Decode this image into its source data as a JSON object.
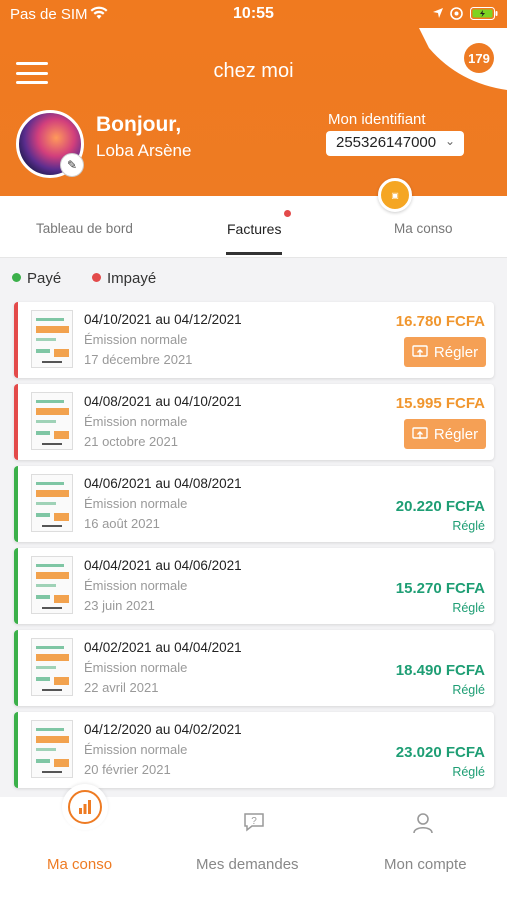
{
  "status": {
    "carrier": "Pas de SIM",
    "time": "10:55"
  },
  "header": {
    "title": "chez moi",
    "badge_text": "179"
  },
  "profile": {
    "greeting": "Bonjour,",
    "name": "Loba Arsène",
    "id_label": "Mon identifiant",
    "id_value": "255326147000"
  },
  "tabs": [
    {
      "label": "Tableau de bord"
    },
    {
      "label": "Factures"
    },
    {
      "label": "Ma conso"
    }
  ],
  "legend": {
    "paid": "Payé",
    "unpaid": "Impayé"
  },
  "colors": {
    "accent": "#ee7b23",
    "paid": "#1e9e74",
    "unpaid": "#e34a4a",
    "amount_unpaid": "#f0962e"
  },
  "invoices": [
    {
      "period": "04/10/2021 au 04/12/2021",
      "type": "Émission normale",
      "date": "17 décembre 2021",
      "amount": "16.780 FCFA",
      "action": "Régler"
    },
    {
      "period": "04/08/2021 au 04/10/2021",
      "type": "Émission normale",
      "date": "21 octobre 2021",
      "amount": "15.995 FCFA",
      "action": "Régler"
    },
    {
      "period": "04/06/2021 au 04/08/2021",
      "type": "Émission normale",
      "date": "16 août 2021",
      "amount": "20.220 FCFA",
      "status": "Réglé"
    },
    {
      "period": "04/04/2021 au 04/06/2021",
      "type": "Émission normale",
      "date": "23 juin 2021",
      "amount": "15.270 FCFA",
      "status": "Réglé"
    },
    {
      "period": "04/02/2021 au 04/04/2021",
      "type": "Émission normale",
      "date": "22 avril 2021",
      "amount": "18.490 FCFA",
      "status": "Réglé"
    },
    {
      "period": "04/12/2020 au 04/02/2021",
      "type": "Émission normale",
      "date": "20 février 2021",
      "amount": "23.020 FCFA",
      "status": "Réglé"
    }
  ],
  "bottom_nav": [
    {
      "label": "Ma conso",
      "icon": "bar-chart-icon"
    },
    {
      "label": "Mes demandes",
      "icon": "chat-question-icon"
    },
    {
      "label": "Mon compte",
      "icon": "user-icon"
    }
  ]
}
